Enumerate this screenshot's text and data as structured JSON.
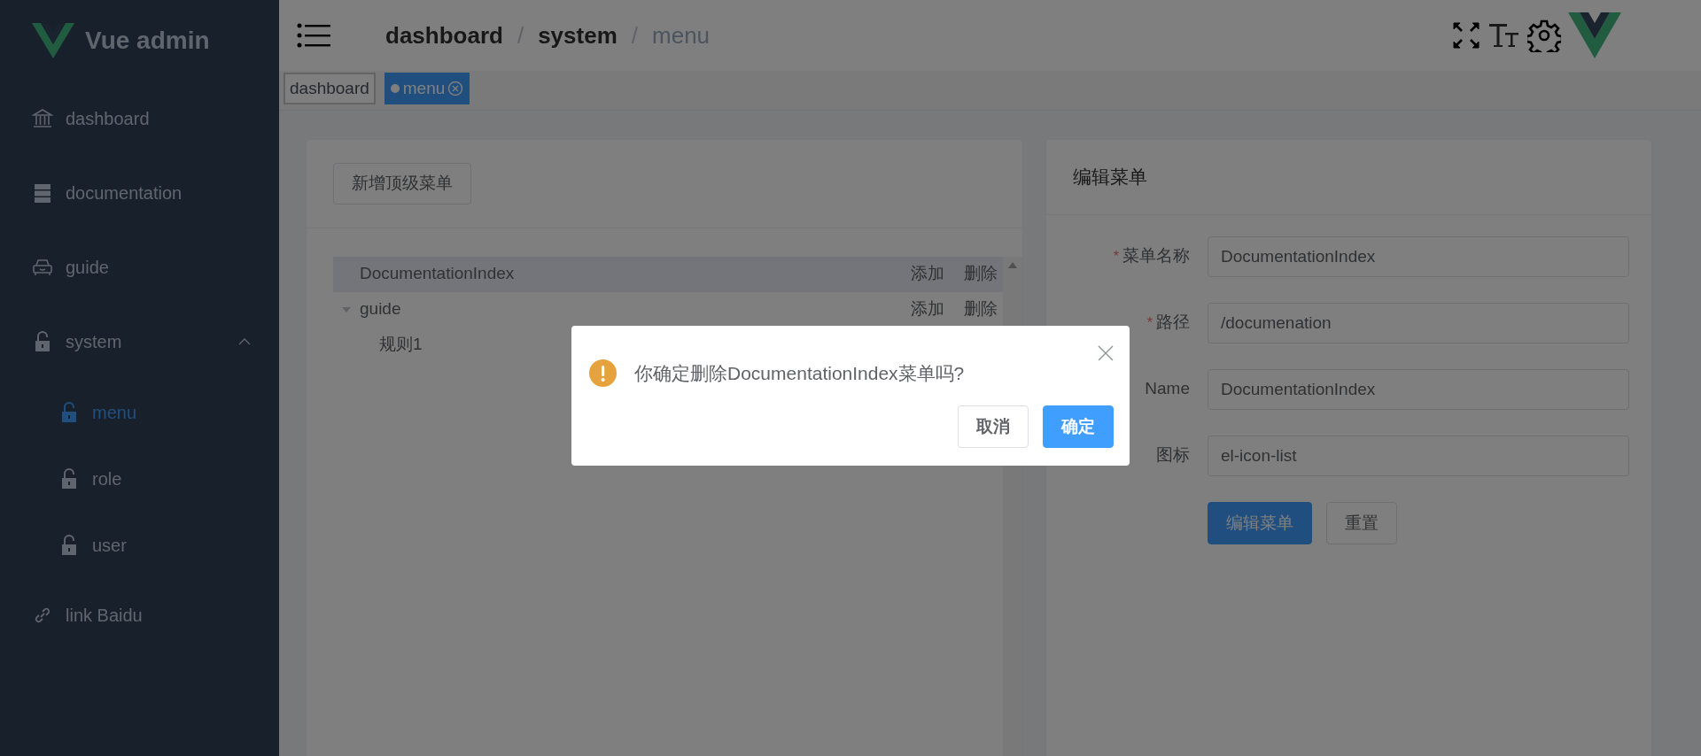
{
  "sidebar": {
    "logo_text": "Vue admin",
    "items": [
      {
        "label": "dashboard",
        "selected": false
      },
      {
        "label": "documentation",
        "selected": false
      },
      {
        "label": "guide",
        "selected": false
      },
      {
        "label": "system",
        "selected": false,
        "expanded": true,
        "children": [
          {
            "label": "menu",
            "selected": true
          },
          {
            "label": "role",
            "selected": false
          },
          {
            "label": "user",
            "selected": false
          }
        ]
      },
      {
        "label": "link Baidu",
        "selected": false
      }
    ]
  },
  "header": {
    "breadcrumb": [
      {
        "label": "dashboard",
        "current": false
      },
      {
        "separator": "/",
        "label": "system",
        "current": false
      },
      {
        "separator": "/",
        "label": "menu",
        "current": true
      }
    ]
  },
  "tags": [
    {
      "label": "dashboard",
      "selected": false
    },
    {
      "label": "menu",
      "selected": true
    }
  ],
  "menu_tree": {
    "add_button": "新增顶级菜单",
    "nodes": [
      {
        "label": "DocumentationIndex",
        "selected": true,
        "actions": [
          "添加",
          "删除"
        ]
      },
      {
        "label": "guide",
        "selected": false,
        "expanded": true,
        "actions": [
          "添加",
          "删除"
        ],
        "children": [
          {
            "label": "规则1",
            "selected": false
          }
        ]
      }
    ]
  },
  "edit_form": {
    "title": "编辑菜单",
    "fields": [
      {
        "required_mark": "*",
        "label": "菜单名称",
        "value": "DocumentationIndex"
      },
      {
        "required_mark": "*",
        "label": "路径",
        "value": "/documenation"
      },
      {
        "label": "Name",
        "value": "DocumentationIndex"
      },
      {
        "label": "图标",
        "value": "el-icon-list"
      }
    ],
    "buttons": [
      {
        "label": "编辑菜单",
        "kind": "primary"
      },
      {
        "label": "重置",
        "kind": "default"
      }
    ]
  },
  "dialog": {
    "message": "你确定删除DocumentationIndex菜单吗?",
    "buttons": [
      {
        "label": "取消",
        "kind": "default"
      },
      {
        "label": "确定",
        "kind": "primary"
      }
    ]
  }
}
